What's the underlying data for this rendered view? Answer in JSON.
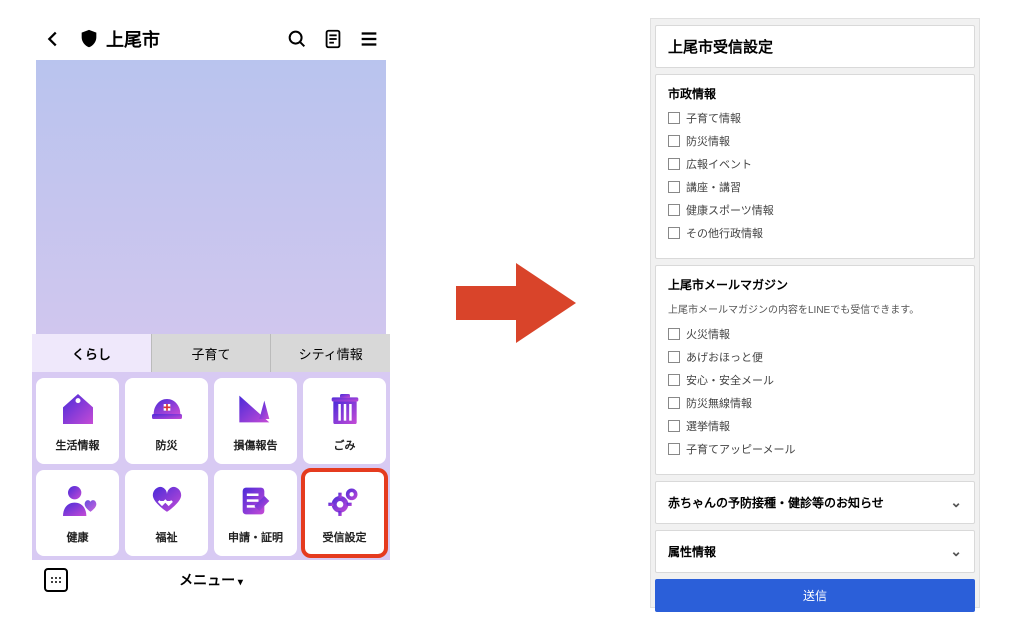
{
  "left": {
    "city_name": "上尾市",
    "tabs": [
      "くらし",
      "子育て",
      "シティ情報"
    ],
    "active_tab": 0,
    "tiles": [
      {
        "label": "生活情報",
        "icon": "house"
      },
      {
        "label": "防災",
        "icon": "helmet"
      },
      {
        "label": "損傷報告",
        "icon": "cone"
      },
      {
        "label": "ごみ",
        "icon": "trash"
      },
      {
        "label": "健康",
        "icon": "person-heart"
      },
      {
        "label": "福祉",
        "icon": "handshake"
      },
      {
        "label": "申請・証明",
        "icon": "doc-pen"
      },
      {
        "label": "受信設定",
        "icon": "gears",
        "highlight": true
      }
    ],
    "footer_menu": "メニュー"
  },
  "right": {
    "title": "上尾市受信設定",
    "section1_title": "市政情報",
    "section1_items": [
      "子育て情報",
      "防災情報",
      "広報イベント",
      "講座・講習",
      "健康スポーツ情報",
      "その他行政情報"
    ],
    "section2_title": "上尾市メールマガジン",
    "section2_sub": "上尾市メールマガジンの内容をLINEでも受信できます。",
    "section2_items": [
      "火災情報",
      "あげおほっと便",
      "安心・安全メール",
      "防災無線情報",
      "選挙情報",
      "子育てアッピーメール"
    ],
    "accordion1": "赤ちゃんの予防接種・健診等のお知らせ",
    "accordion2": "属性情報",
    "submit": "送信"
  }
}
